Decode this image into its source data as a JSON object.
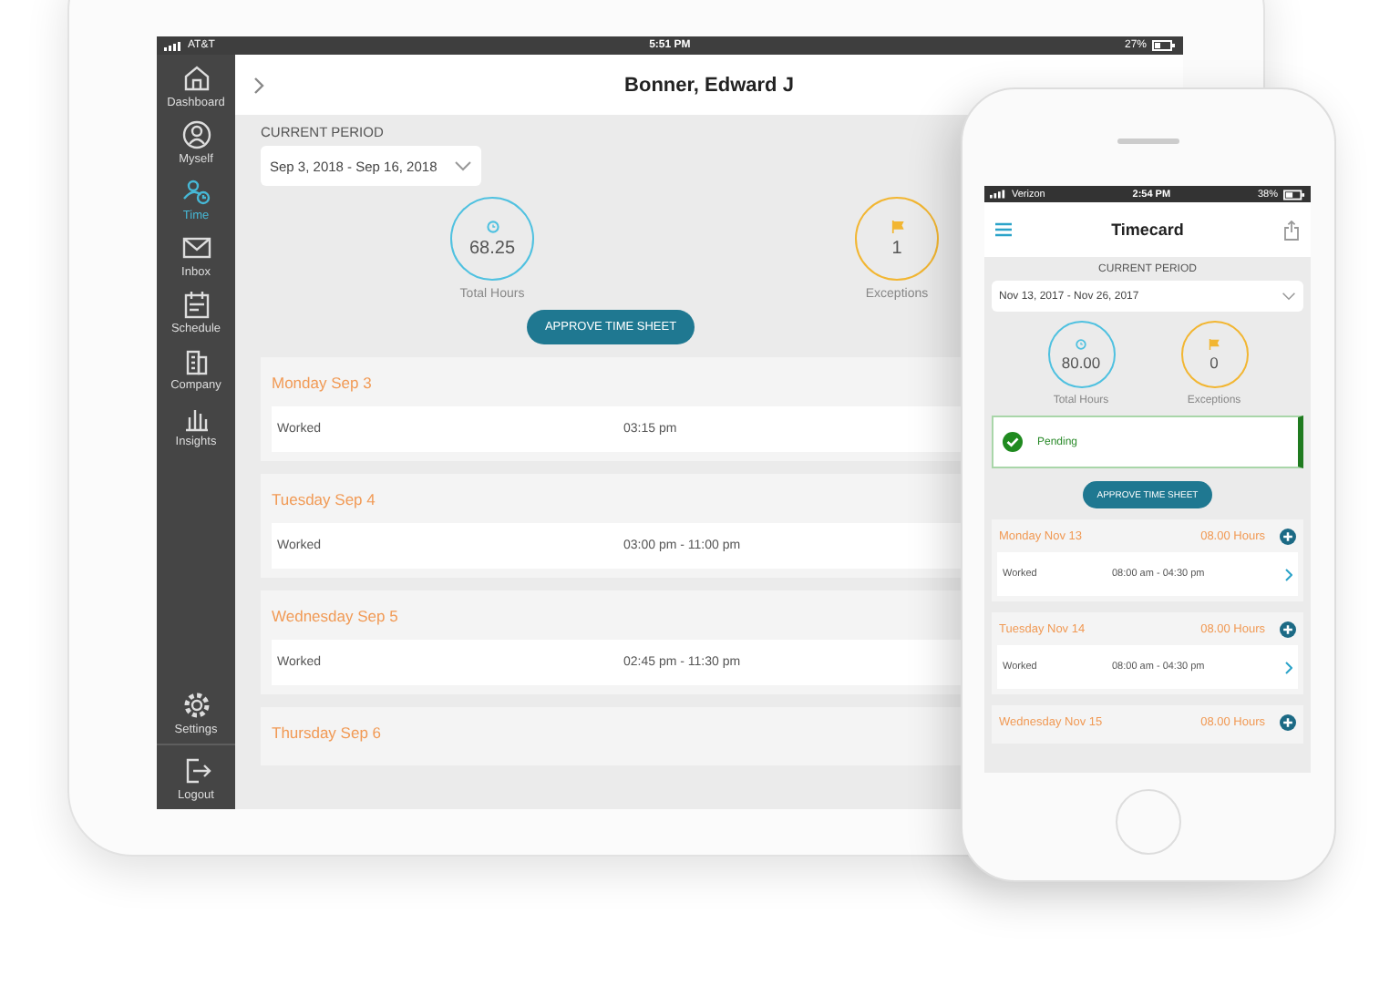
{
  "tablet": {
    "status_bar": {
      "carrier": "AT&T",
      "time": "5:51 PM",
      "battery": "27%"
    },
    "sidebar": {
      "items": [
        {
          "label": "Dashboard",
          "selected": false
        },
        {
          "label": "Myself",
          "selected": false
        },
        {
          "label": "Time",
          "selected": true
        },
        {
          "label": "Inbox",
          "selected": false
        },
        {
          "label": "Schedule",
          "selected": false
        },
        {
          "label": "Company",
          "selected": false
        },
        {
          "label": "Insights",
          "selected": false
        }
      ],
      "bottom_items": [
        {
          "label": "Settings",
          "selected": false
        },
        {
          "label": "Logout",
          "selected": false
        }
      ]
    },
    "header": {
      "title": "Bonner, Edward J"
    },
    "period": {
      "label": "CURRENT PERIOD",
      "value": "Sep 3, 2018 - Sep 16, 2018"
    },
    "stats": [
      {
        "kind": "hours",
        "value": "68.25",
        "label": "Total Hours"
      },
      {
        "kind": "exceptions",
        "value": "1",
        "label": "Exceptions"
      }
    ],
    "approve_button": "APPROVE TIME SHEET",
    "days": [
      {
        "title": "Monday Sep 3",
        "entries": [
          {
            "type": "Worked",
            "time": "03:15 pm"
          }
        ]
      },
      {
        "title": "Tuesday Sep 4",
        "entries": [
          {
            "type": "Worked",
            "time": "03:00 pm - 11:00 pm"
          }
        ]
      },
      {
        "title": "Wednesday Sep 5",
        "entries": [
          {
            "type": "Worked",
            "time": "02:45 pm - 11:30 pm"
          }
        ]
      },
      {
        "title": "Thursday Sep 6"
      }
    ]
  },
  "phone": {
    "status_bar": {
      "carrier": "Verizon",
      "time": "2:54 PM",
      "battery": "38%"
    },
    "header": {
      "title": "Timecard"
    },
    "period": {
      "label": "CURRENT PERIOD",
      "value": "Nov 13, 2017 - Nov 26, 2017"
    },
    "stats": [
      {
        "kind": "hours",
        "value": "80.00",
        "label": "Total Hours"
      },
      {
        "kind": "exceptions",
        "value": "0",
        "label": "Exceptions"
      }
    ],
    "status": {
      "label": "Pending"
    },
    "approve_button": "APPROVE TIME SHEET",
    "days": [
      {
        "title": "Monday Nov 13",
        "hours": "08.00 Hours",
        "entries": [
          {
            "type": "Worked",
            "time": "08:00 am - 04:30 pm"
          }
        ]
      },
      {
        "title": "Tuesday Nov 14",
        "hours": "08.00 Hours",
        "entries": [
          {
            "type": "Worked",
            "time": "08:00 am - 04:30 pm"
          }
        ]
      },
      {
        "title": "Wednesday Nov 15",
        "hours": "08.00 Hours"
      }
    ]
  }
}
